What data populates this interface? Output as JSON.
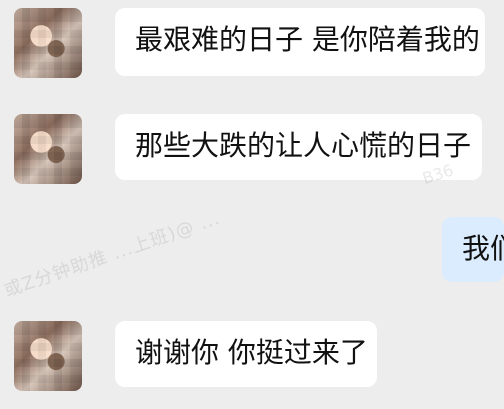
{
  "messages": [
    {
      "side": "incoming",
      "text": "最艰难的日子 是你陪着我的"
    },
    {
      "side": "incoming",
      "text": "那些大跌的让人心慌的日子"
    },
    {
      "side": "outgoing",
      "text": "我们"
    },
    {
      "side": "incoming",
      "text": "谢谢你 你挺过来了"
    }
  ],
  "watermark": {
    "text_primary": "或Z分钟助推 ...上班)@ ...",
    "text_secondary": "B36"
  },
  "avatar_icon": "blurred-avatar-icon",
  "colors": {
    "background": "#ededed",
    "incoming_bubble": "#ffffff",
    "outgoing_bubble": "#dcecff",
    "text": "#111111"
  }
}
